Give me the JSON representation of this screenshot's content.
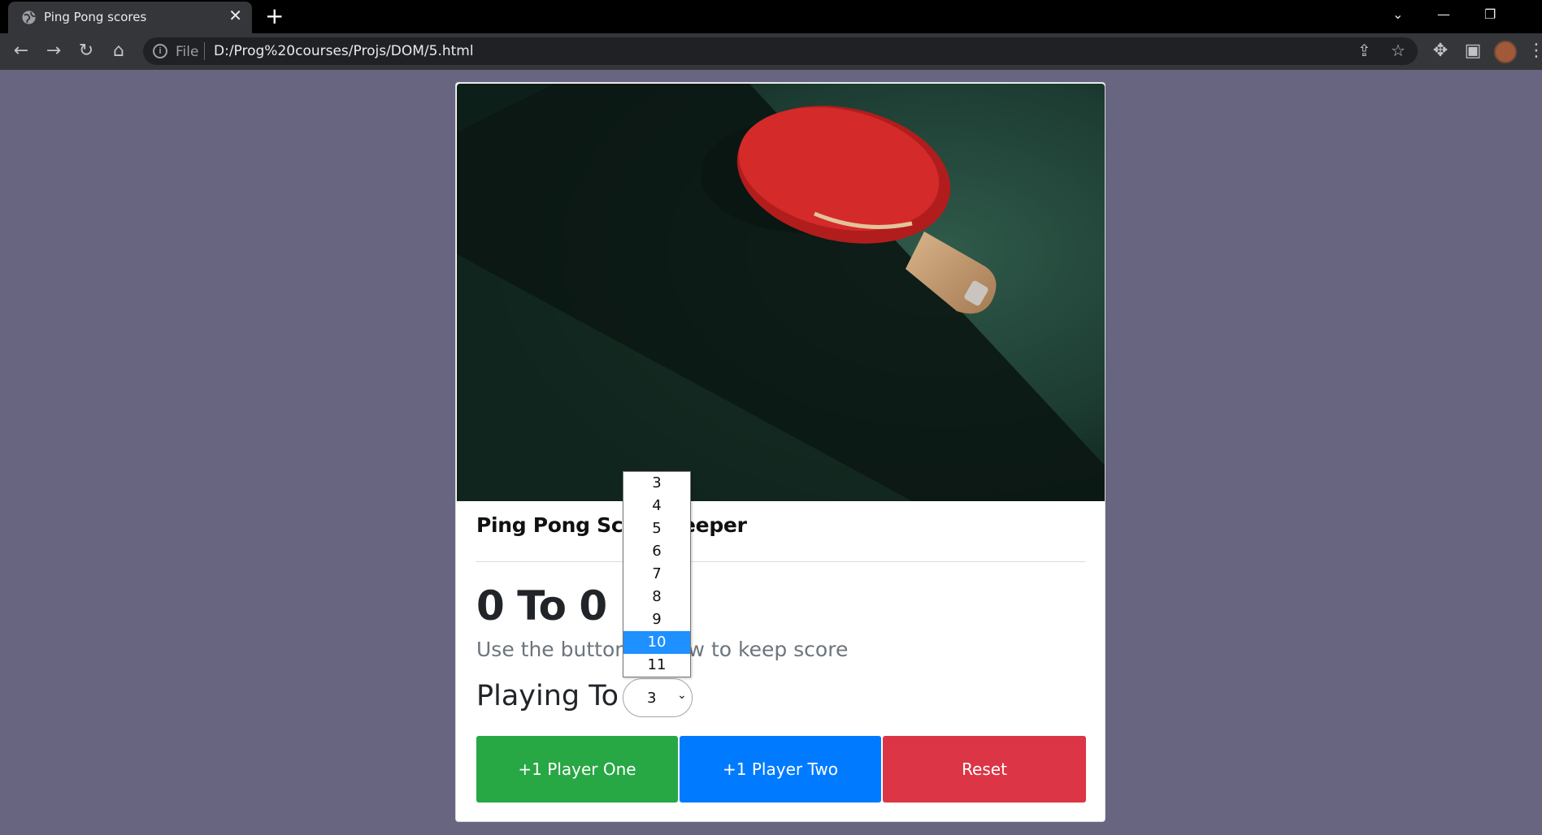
{
  "browser": {
    "tab_title": "Ping Pong scores",
    "tab_close": "✕",
    "new_tab": "+",
    "scheme_label": "File",
    "url": "D:/Prog%20courses/Projs/DOM/5.html",
    "window_controls": {
      "dropdown": "⌄",
      "minimize": "—",
      "restore": "❐"
    }
  },
  "page": {
    "card_title": "Ping Pong Score Keeper",
    "score_text": "0 To 0",
    "hint_text": "Use the buttons below to keep score",
    "playing_to_label": "Playing To",
    "select": {
      "selected_value": "3",
      "options": [
        "3",
        "4",
        "5",
        "6",
        "7",
        "8",
        "9",
        "10",
        "11"
      ],
      "highlighted_option": "10"
    },
    "buttons": {
      "player_one": "+1 Player One",
      "player_two": "+1 Player Two",
      "reset": "Reset"
    }
  },
  "colors": {
    "page_background": "#676580",
    "player_one": "#28a745",
    "player_two": "#007bff",
    "reset": "#dc3545",
    "highlight": "#1e90ff"
  }
}
